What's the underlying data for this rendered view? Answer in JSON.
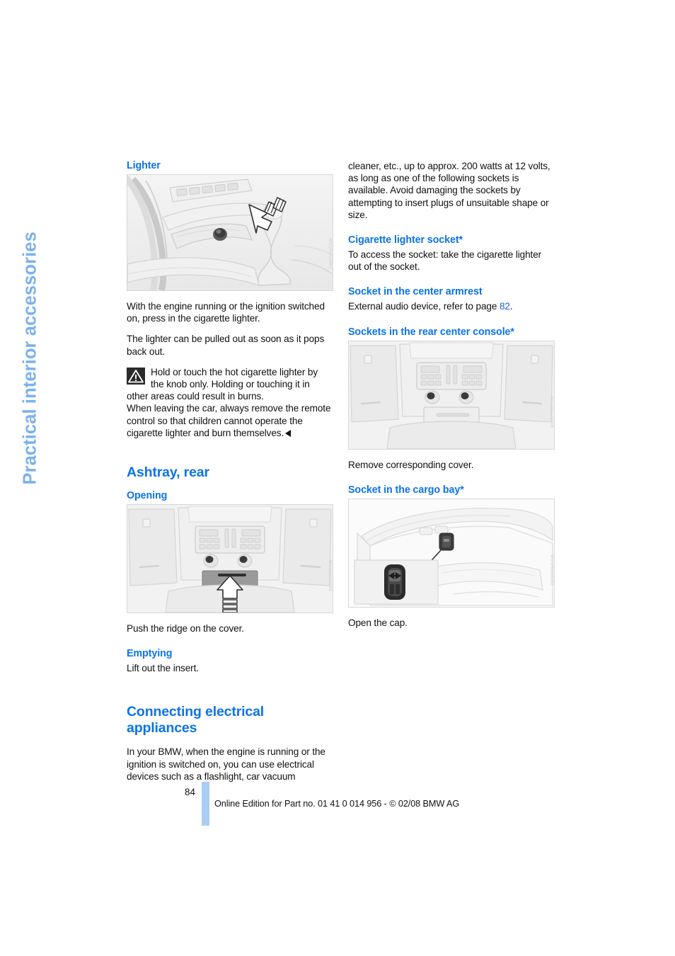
{
  "chapter_tab": {
    "label": "Practical interior accessories",
    "color": "#7cb1ee"
  },
  "theme": {
    "heading_blue": "#0b74e8",
    "link_blue": "#1a5fe0",
    "page_bar_blue": "#a9cdf5"
  },
  "left_column": {
    "lighter": {
      "heading": "Lighter",
      "figure_code": "WVUHAU0463",
      "para1": "With the engine running or the ignition switched on, press in the cigarette lighter.",
      "para2": "The lighter can be pulled out as soon as it pops back out.",
      "warning_icon": "warning-triangle-icon",
      "warning_text": "Hold or touch the hot cigarette lighter by the knob only. Holding or touching it in other areas could result in burns.",
      "warning_text2": "When leaving the car, always remove the remote control so that children cannot operate the cigarette lighter and burn themselves."
    },
    "ashtray": {
      "heading": "Ashtray, rear",
      "opening_heading": "Opening",
      "figure_code": "WVUHAU0448",
      "opening_text": "Push the ridge on the cover.",
      "emptying_heading": "Emptying",
      "emptying_text": "Lift out the insert."
    },
    "connecting": {
      "heading_line1": "Connecting electrical",
      "heading_line2": "appliances",
      "para": "In your BMW, when the engine is running or the ignition is switched on, you can use electrical devices such as a flashlight, car vacuum"
    }
  },
  "right_column": {
    "continued_para": "cleaner, etc., up to approx. 200 watts at 12 volts, as long as one of the following sockets is available. Avoid damaging the sockets by attempting to insert plugs of unsuitable shape or size.",
    "cigarette_socket": {
      "heading": "Cigarette lighter socket*",
      "text": "To access the socket: take the cigarette lighter out of the socket."
    },
    "armrest_socket": {
      "heading": "Socket in the center armrest",
      "text_before": "External audio device, refer to page ",
      "page_link": "82",
      "text_after": "."
    },
    "rear_console_sockets": {
      "heading": "Sockets in the rear center console*",
      "figure_code": "WVUHAU0448",
      "caption": "Remove corresponding cover."
    },
    "cargo_socket": {
      "heading": "Socket in the cargo bay*",
      "figure_code": "WVUHAU0452",
      "caption": "Open the cap."
    }
  },
  "footer": {
    "page_number": "84",
    "imprint": "Online Edition for Part no. 01 41 0 014 956 - © 02/08 BMW AG"
  }
}
